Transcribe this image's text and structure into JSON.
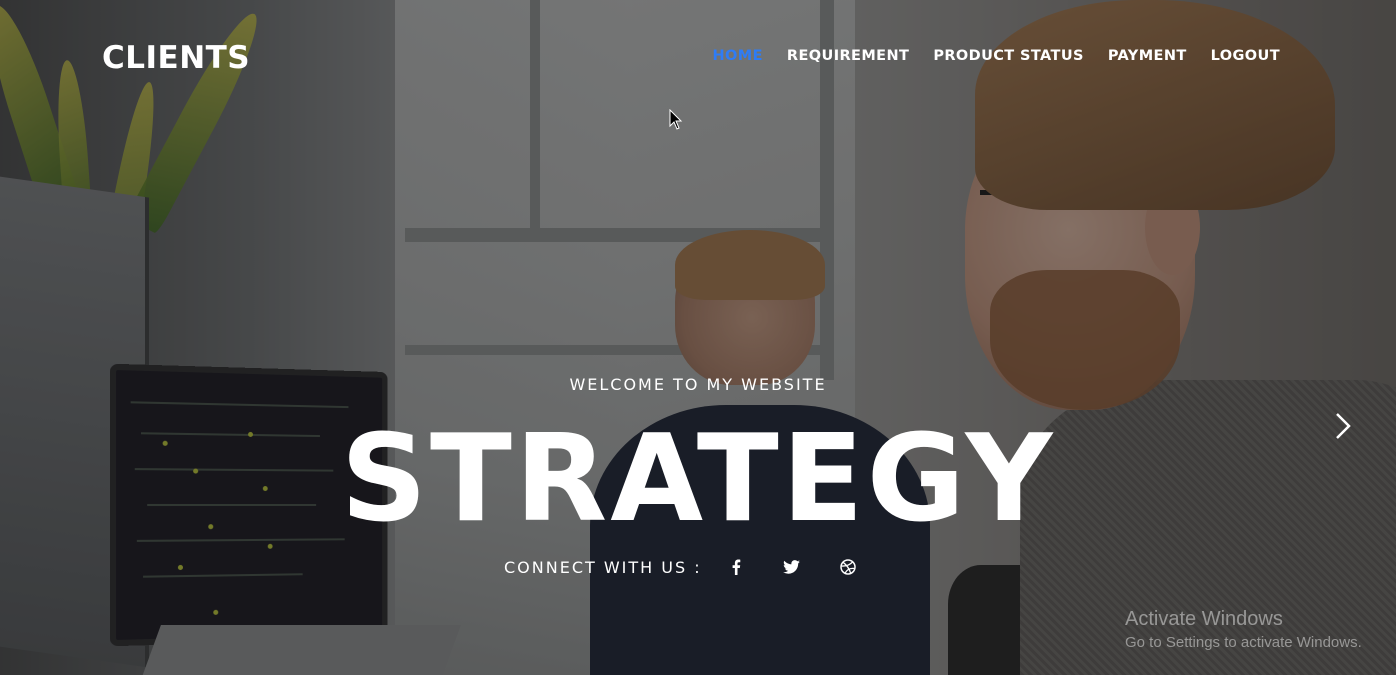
{
  "header": {
    "brand": "CLIENTS",
    "nav": [
      {
        "label": "HOME",
        "active": true
      },
      {
        "label": "REQUIREMENT",
        "active": false
      },
      {
        "label": "PRODUCT STATUS",
        "active": false
      },
      {
        "label": "PAYMENT",
        "active": false
      },
      {
        "label": "LOGOUT",
        "active": false
      }
    ]
  },
  "hero": {
    "welcome": "WELCOME TO MY WEBSITE",
    "headline": "STRATEGY",
    "connect_label": "CONNECT WITH US :",
    "social_icons": [
      "facebook-icon",
      "twitter-icon",
      "dribbble-icon"
    ],
    "next_icon": "chevron-right-icon"
  },
  "watermark": {
    "title": "Activate Windows",
    "subtitle": "Go to Settings to activate Windows."
  },
  "colors": {
    "accent": "#2e7cf6",
    "text": "#ffffff"
  }
}
